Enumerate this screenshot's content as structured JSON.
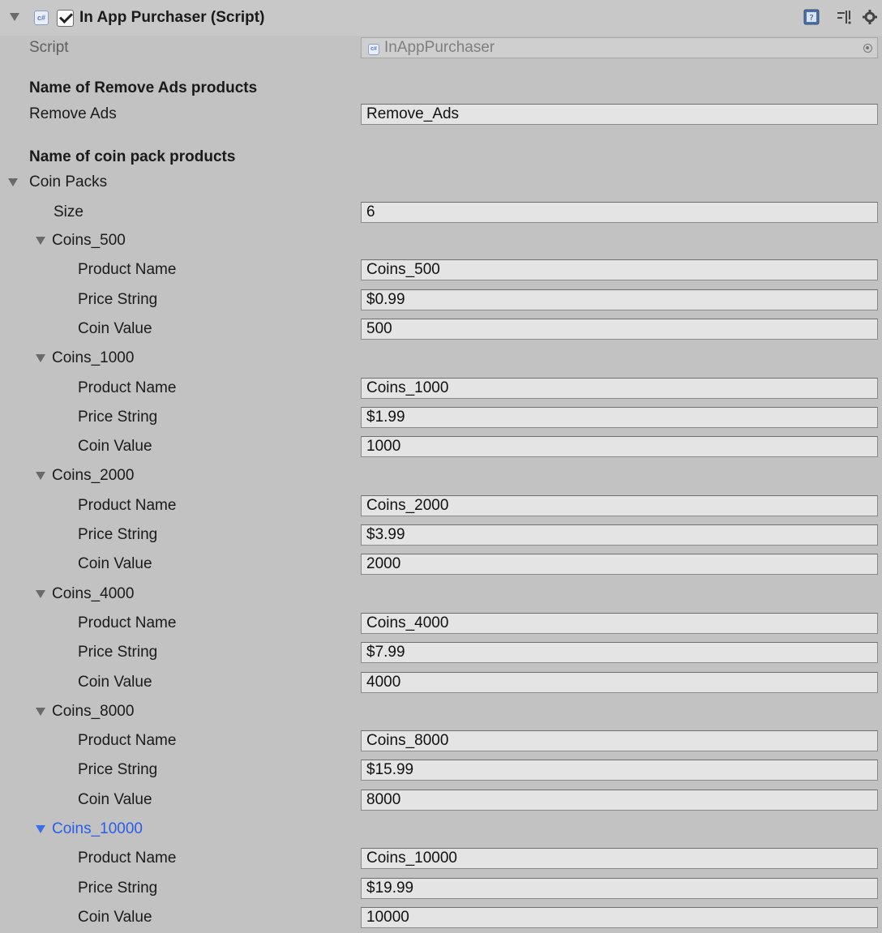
{
  "component": {
    "title": "In App Purchaser (Script)",
    "enabled": true,
    "script_label": "Script",
    "script_value": "InAppPurchaser",
    "cs_icon_text": "c#",
    "icons": [
      "foldout-arrow-icon",
      "csharp-script-icon",
      "help-book-icon",
      "preset-icon",
      "gear-icon",
      "object-picker-icon"
    ]
  },
  "remove_ads": {
    "header": "Name of Remove Ads products",
    "label": "Remove Ads",
    "value": "Remove_Ads"
  },
  "coin_packs": {
    "header": "Name of coin pack products",
    "label": "Coin Packs",
    "size_label": "Size",
    "size_value": "6",
    "field_labels": {
      "product_name": "Product Name",
      "price_string": "Price String",
      "coin_value": "Coin Value"
    },
    "items": [
      {
        "name": "Coins_500",
        "product_name": "Coins_500",
        "price_string": "$0.99",
        "coin_value": "500"
      },
      {
        "name": "Coins_1000",
        "product_name": "Coins_1000",
        "price_string": "$1.99",
        "coin_value": "1000"
      },
      {
        "name": "Coins_2000",
        "product_name": "Coins_2000",
        "price_string": "$3.99",
        "coin_value": "2000"
      },
      {
        "name": "Coins_4000",
        "product_name": "Coins_4000",
        "price_string": "$7.99",
        "coin_value": "4000"
      },
      {
        "name": "Coins_8000",
        "product_name": "Coins_8000",
        "price_string": "$15.99",
        "coin_value": "8000"
      },
      {
        "name": "Coins_10000",
        "product_name": "Coins_10000",
        "price_string": "$19.99",
        "coin_value": "10000"
      }
    ]
  },
  "colors": {
    "background": "#c2c2c2",
    "selected_text": "#2a5ee8"
  }
}
